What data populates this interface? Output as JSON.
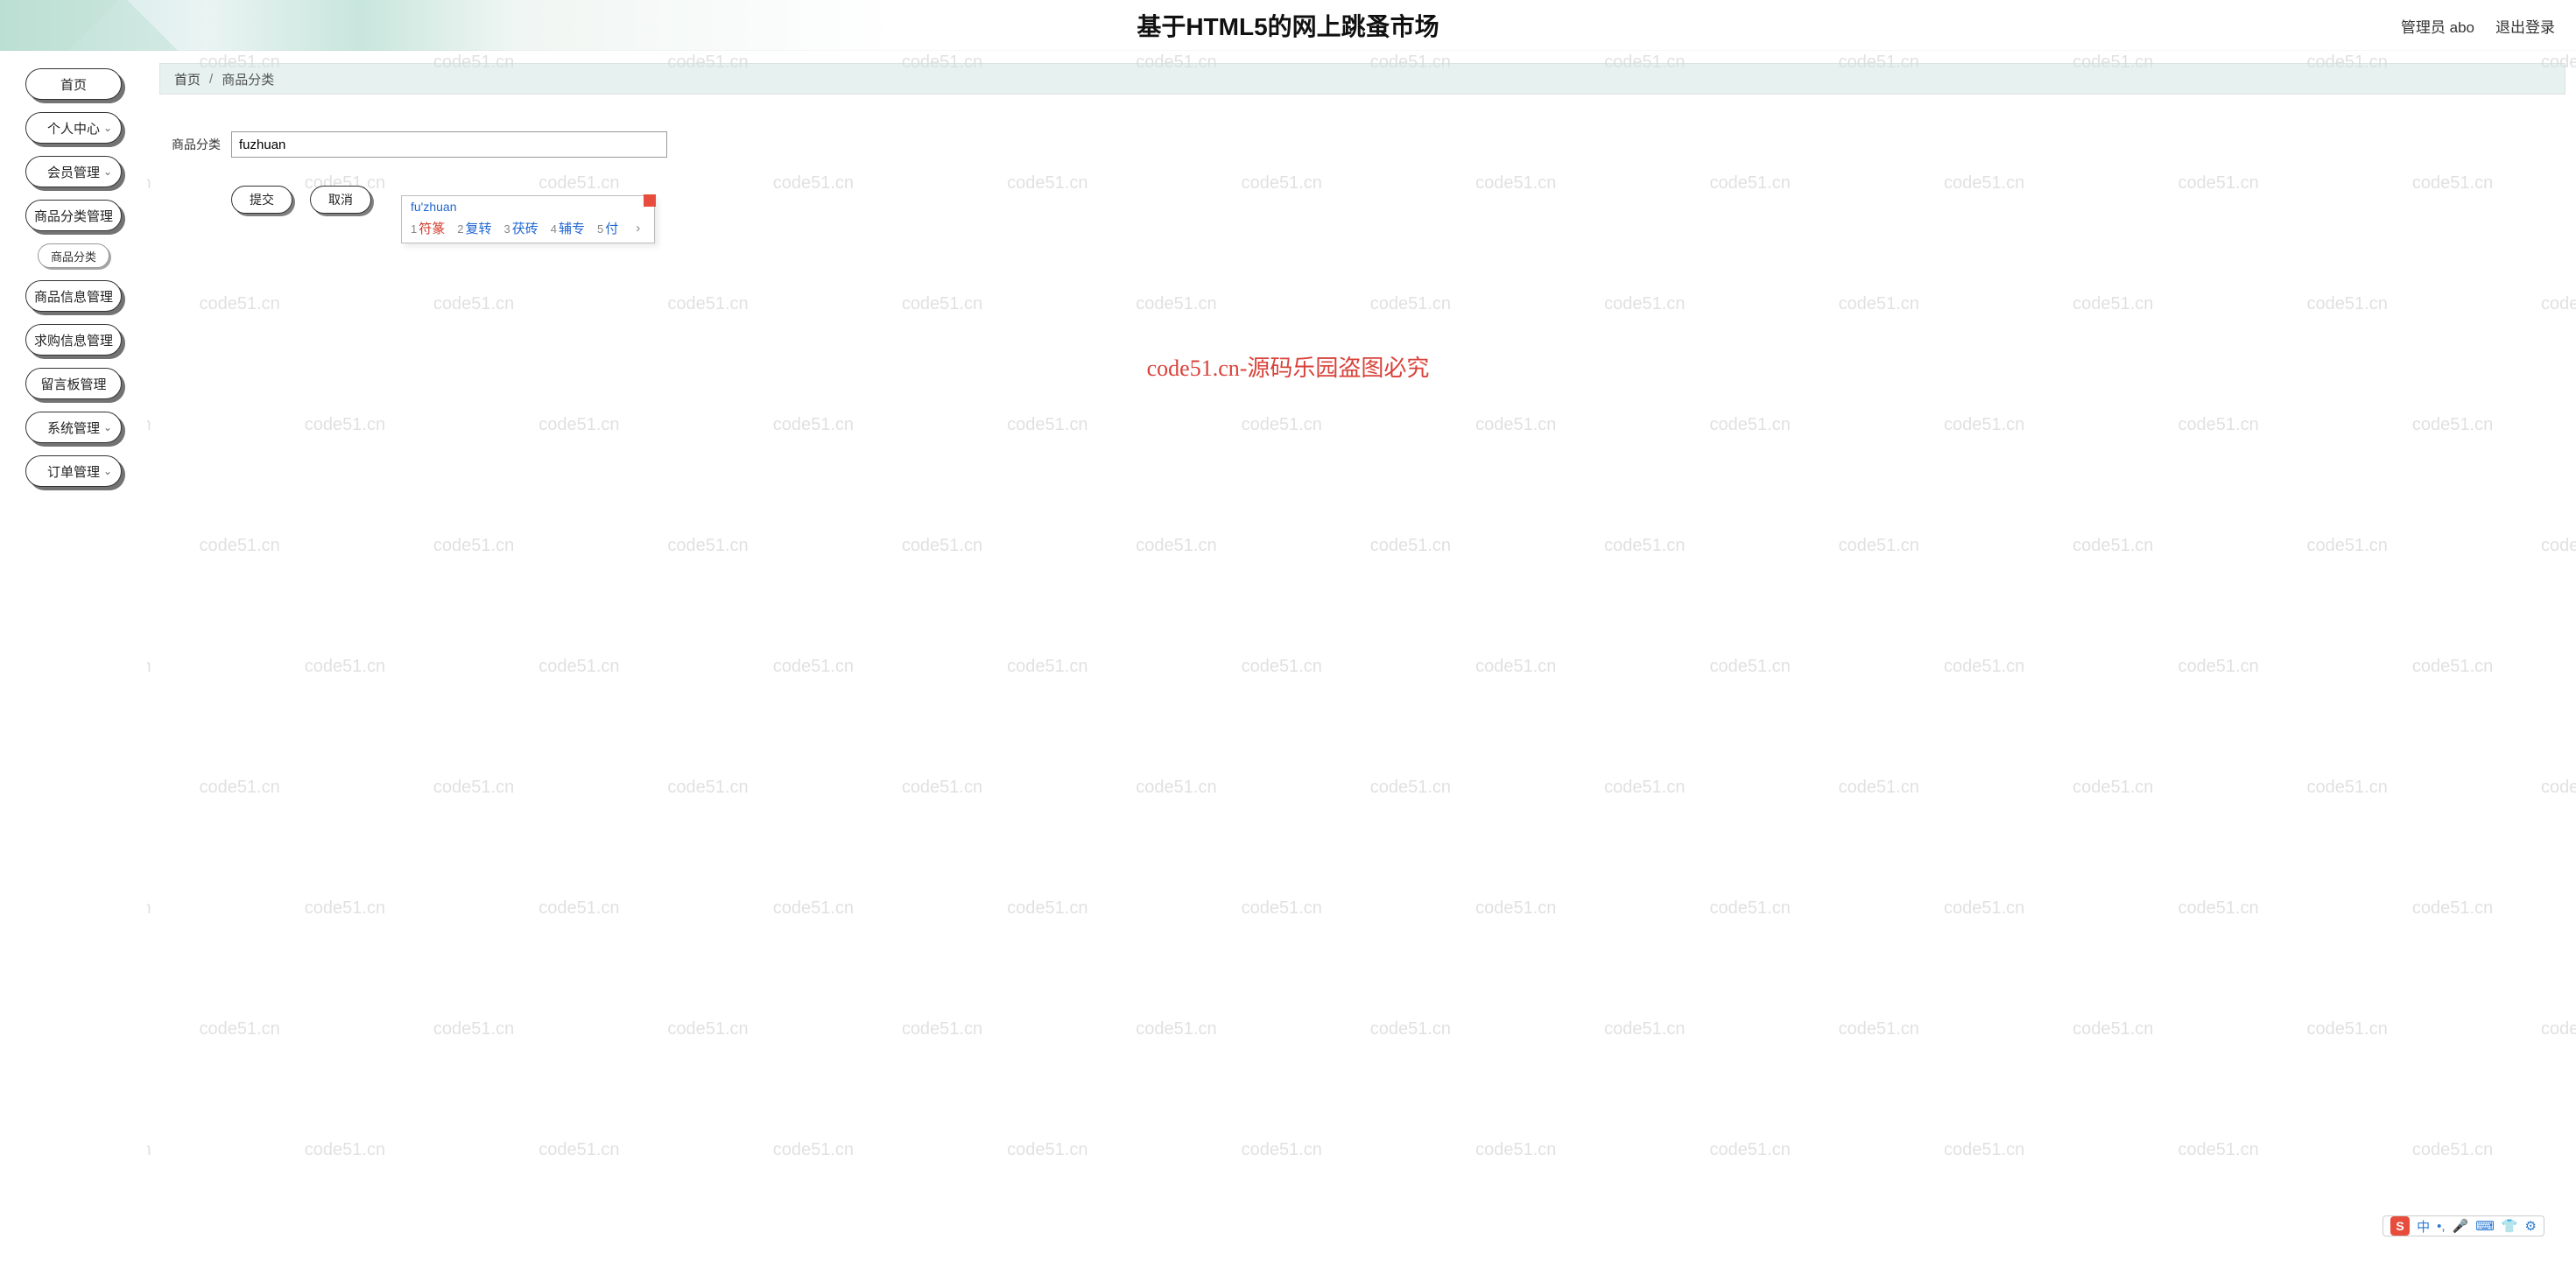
{
  "header": {
    "title": "基于HTML5的网上跳蚤市场",
    "admin_label": "管理员 abo",
    "logout_label": "退出登录"
  },
  "sidebar": {
    "items": [
      {
        "label": "首页",
        "expandable": false
      },
      {
        "label": "个人中心",
        "expandable": true
      },
      {
        "label": "会员管理",
        "expandable": true
      },
      {
        "label": "商品分类管理",
        "expandable": false
      },
      {
        "label": "商品信息管理",
        "expandable": false
      },
      {
        "label": "求购信息管理",
        "expandable": false
      },
      {
        "label": "留言板管理",
        "expandable": false
      },
      {
        "label": "系统管理",
        "expandable": true
      },
      {
        "label": "订单管理",
        "expandable": true
      }
    ],
    "sub_item": "商品分类"
  },
  "breadcrumb": {
    "home": "首页",
    "current": "商品分类"
  },
  "form": {
    "field_label": "商品分类",
    "field_value": "fuzhuan",
    "submit_label": "提交",
    "cancel_label": "取消"
  },
  "ime": {
    "pinyin": "fu'zhuan",
    "candidates": [
      {
        "num": "1",
        "text": "符篆"
      },
      {
        "num": "2",
        "text": "复转"
      },
      {
        "num": "3",
        "text": "茯砖"
      },
      {
        "num": "4",
        "text": "辅专"
      },
      {
        "num": "5",
        "text": "付"
      }
    ],
    "arrow": "›"
  },
  "toolbar": {
    "logo": "S",
    "icons": [
      "中",
      "•,",
      "🎤",
      "⌨",
      "👕",
      "⚙"
    ]
  },
  "watermark": {
    "text": "code51.cn",
    "center": "code51.cn-源码乐园盗图必究"
  }
}
